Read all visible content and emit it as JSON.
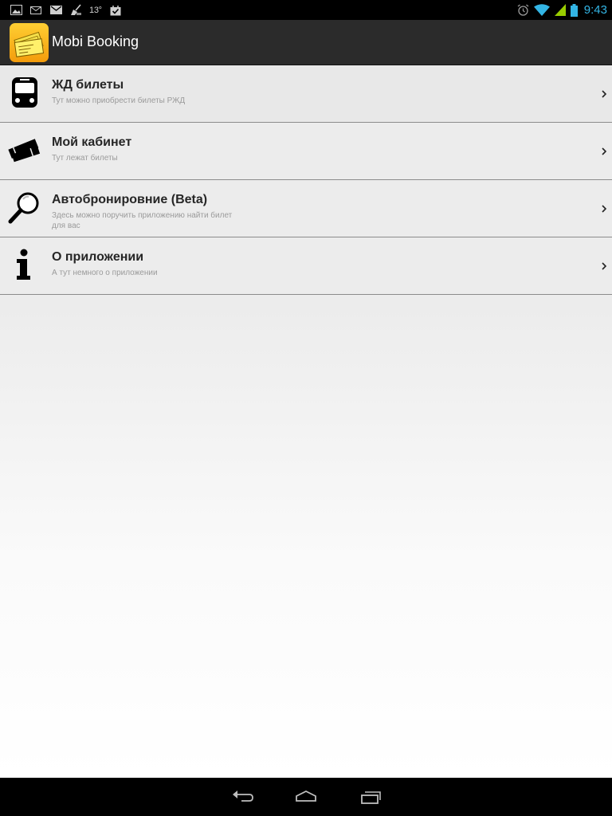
{
  "status_bar": {
    "temperature": "13°",
    "time": "9:43",
    "icons": [
      "gallery-icon",
      "email-icon",
      "gmail-icon",
      "broom-icon",
      "task-icon",
      "alarm-icon",
      "wifi-icon",
      "signal-icon",
      "battery-icon"
    ],
    "time_color": "#33b5e5"
  },
  "action_bar": {
    "title": "Mobi Booking",
    "icon": "tickets-app-icon",
    "icon_color": "#f6b314"
  },
  "menu": {
    "items": [
      {
        "title": "ЖД билеты",
        "subtitle": "Тут можно приобрести билеты РЖД",
        "icon": "train-icon"
      },
      {
        "title": "Мой кабинет",
        "subtitle": "Тут лежат билеты",
        "icon": "tickets-icon"
      },
      {
        "title": "Автобронировние (Beta)",
        "subtitle": "Здесь можно поручить приложению найти билет для вас",
        "icon": "magnifier-icon"
      },
      {
        "title": "О приложении",
        "subtitle": "А тут немного о приложении",
        "icon": "info-icon"
      }
    ]
  },
  "nav_bar": {
    "buttons": [
      "back-icon",
      "home-icon",
      "recent-apps-icon"
    ]
  }
}
